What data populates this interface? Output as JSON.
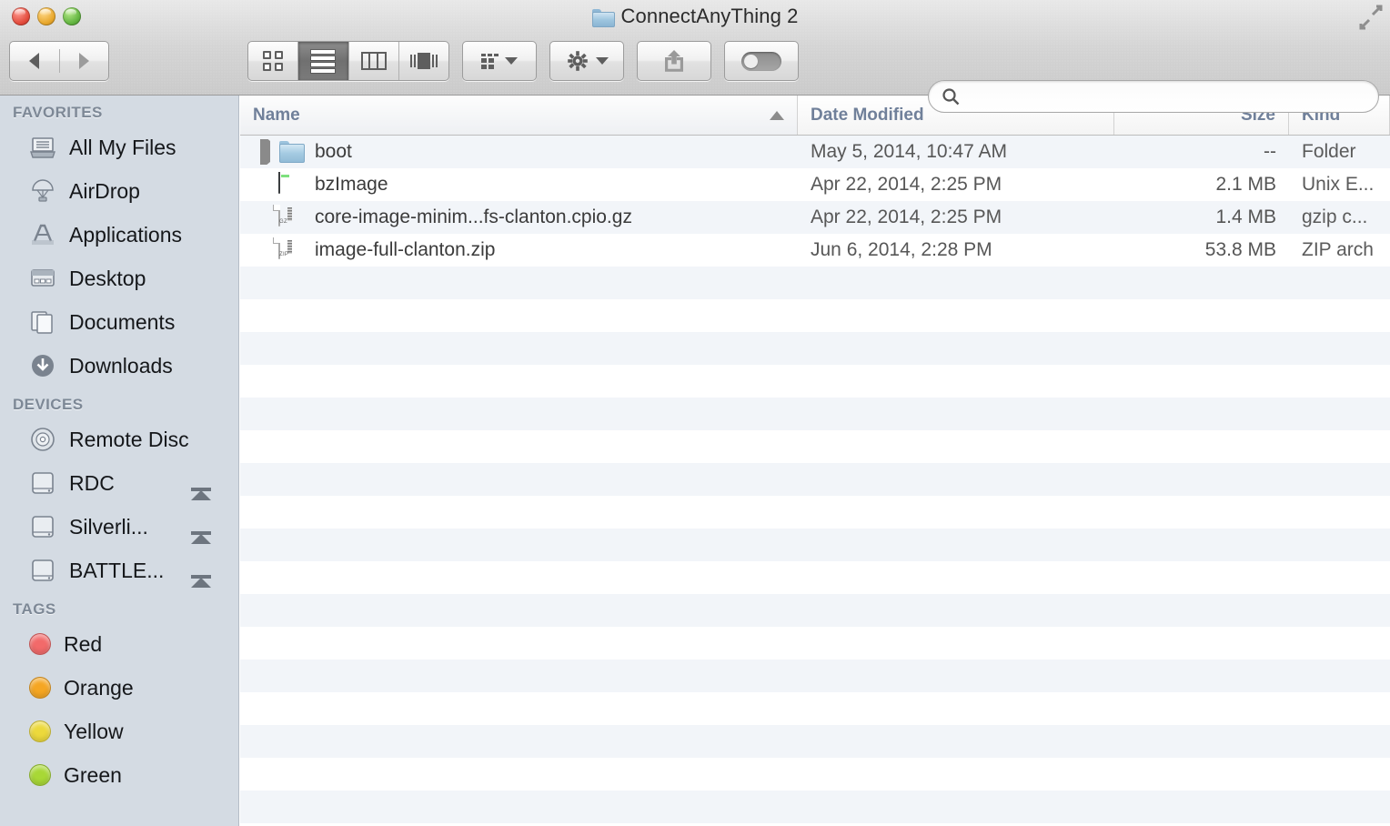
{
  "window": {
    "title": "ConnectAnyThing 2",
    "title_icon": "folder-icon",
    "controls": {
      "close": "close-button",
      "minimize": "minimize-button",
      "zoom": "zoom-button"
    },
    "fullscreen_icon": "fullscreen-expand-icon"
  },
  "toolbar": {
    "back_label": "Back",
    "forward_label": "Forward",
    "view_modes": [
      {
        "name": "icon-view",
        "label": "Icon View",
        "active": false
      },
      {
        "name": "list-view",
        "label": "List View",
        "active": true
      },
      {
        "name": "column-view",
        "label": "Column View",
        "active": false
      },
      {
        "name": "coverflow-view",
        "label": "Cover Flow View",
        "active": false
      }
    ],
    "arrange_label": "Arrange",
    "action_label": "Action",
    "share_label": "Share",
    "tags_label": "Edit Tags"
  },
  "search": {
    "value": "",
    "placeholder": ""
  },
  "sidebar": {
    "sections": [
      {
        "title": "FAVORITES",
        "items": [
          {
            "label": "All My Files",
            "icon": "all-my-files-icon",
            "eject": false
          },
          {
            "label": "AirDrop",
            "icon": "airdrop-icon",
            "eject": false
          },
          {
            "label": "Applications",
            "icon": "applications-icon",
            "eject": false
          },
          {
            "label": "Desktop",
            "icon": "desktop-icon",
            "eject": false
          },
          {
            "label": "Documents",
            "icon": "documents-icon",
            "eject": false
          },
          {
            "label": "Downloads",
            "icon": "downloads-icon",
            "eject": false
          }
        ]
      },
      {
        "title": "DEVICES",
        "items": [
          {
            "label": "Remote Disc",
            "icon": "optical-disc-icon",
            "eject": false
          },
          {
            "label": "RDC",
            "icon": "hard-drive-icon",
            "eject": true
          },
          {
            "label": "Silverli...",
            "icon": "hard-drive-icon",
            "eject": true
          },
          {
            "label": "BATTLE...",
            "icon": "hard-drive-icon",
            "eject": true
          }
        ]
      },
      {
        "title": "TAGS",
        "items": [
          {
            "label": "Red",
            "icon": "tag-dot-icon",
            "color": "#f26a6a",
            "eject": false
          },
          {
            "label": "Orange",
            "icon": "tag-dot-icon",
            "color": "#f5a623",
            "eject": false
          },
          {
            "label": "Yellow",
            "icon": "tag-dot-icon",
            "color": "#ecd93c",
            "eject": false
          },
          {
            "label": "Green",
            "icon": "tag-dot-icon",
            "color": "#a8d836",
            "eject": false
          }
        ]
      }
    ]
  },
  "filelist": {
    "columns": [
      {
        "key": "name",
        "label": "Name",
        "sorted": true,
        "sort_direction": "ascending"
      },
      {
        "key": "date",
        "label": "Date Modified",
        "sorted": false
      },
      {
        "key": "size",
        "label": "Size",
        "sorted": false
      },
      {
        "key": "kind",
        "label": "Kind",
        "sorted": false
      }
    ],
    "rows": [
      {
        "name": "boot",
        "date": "May 5, 2014, 10:47 AM",
        "size": "--",
        "kind": "Folder",
        "icon": "folder-icon",
        "expandable": true
      },
      {
        "name": "bzImage",
        "date": "Apr 22, 2014, 2:25 PM",
        "size": "2.1 MB",
        "kind": "Unix E...",
        "icon": "unix-executable-icon",
        "expandable": false
      },
      {
        "name": "core-image-minim...fs-clanton.cpio.gz",
        "date": "Apr 22, 2014, 2:25 PM",
        "size": "1.4 MB",
        "kind": "gzip c...",
        "icon": "gz-archive-icon",
        "icon_tag": "GZ",
        "expandable": false
      },
      {
        "name": "image-full-clanton.zip",
        "date": "Jun 6, 2014, 2:28 PM",
        "size": "53.8 MB",
        "kind": "ZIP arch",
        "icon": "zip-archive-icon",
        "icon_tag": "ZIP",
        "expandable": false
      }
    ],
    "empty_row_count": 17
  }
}
